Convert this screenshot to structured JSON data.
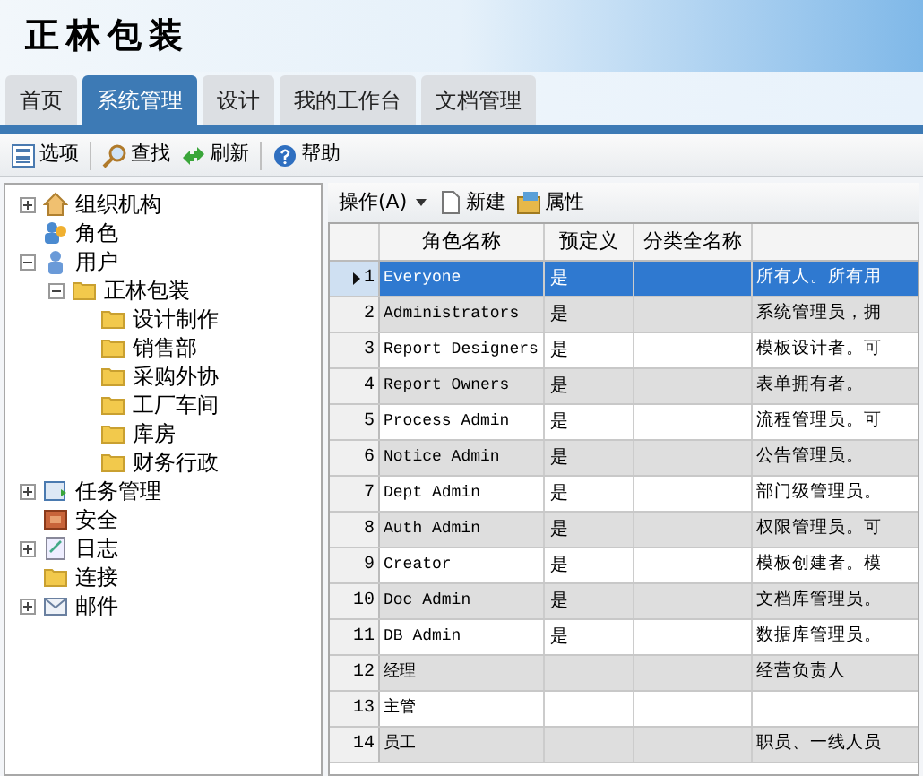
{
  "app_title": "正林包装",
  "tabs": [
    {
      "label": "首页",
      "selected": false
    },
    {
      "label": "系统管理",
      "selected": true
    },
    {
      "label": "设计",
      "selected": false
    },
    {
      "label": "我的工作台",
      "selected": false
    },
    {
      "label": "文档管理",
      "selected": false
    }
  ],
  "toolbar": [
    {
      "kind": "options",
      "label": "选项"
    },
    {
      "kind": "search",
      "label": "查找"
    },
    {
      "kind": "refresh",
      "label": "刷新"
    },
    {
      "kind": "help",
      "label": "帮助"
    }
  ],
  "tree": [
    {
      "label": "组织机构",
      "kind": "org",
      "expanded": false
    },
    {
      "label": "角色",
      "kind": "role"
    },
    {
      "label": "用户",
      "kind": "user",
      "expanded": true,
      "children": [
        {
          "label": "正林包装",
          "kind": "folder",
          "expanded": true,
          "children": [
            {
              "label": "设计制作",
              "kind": "folder"
            },
            {
              "label": "销售部",
              "kind": "folder"
            },
            {
              "label": "采购外协",
              "kind": "folder"
            },
            {
              "label": "工厂车间",
              "kind": "folder"
            },
            {
              "label": "库房",
              "kind": "folder"
            },
            {
              "label": "财务行政",
              "kind": "folder"
            }
          ]
        }
      ]
    },
    {
      "label": "任务管理",
      "kind": "task",
      "expanded": false
    },
    {
      "label": "安全",
      "kind": "security"
    },
    {
      "label": "日志",
      "kind": "log",
      "expanded": false
    },
    {
      "label": "连接",
      "kind": "folder"
    },
    {
      "label": "邮件",
      "kind": "mail",
      "expanded": false
    }
  ],
  "grid_toolbar": [
    {
      "kind": "menu",
      "label": "操作(A)"
    },
    {
      "kind": "new",
      "label": "新建"
    },
    {
      "kind": "properties",
      "label": "属性"
    }
  ],
  "table": {
    "columns": [
      "角色名称",
      "预定义",
      "分类全名称"
    ],
    "rows": [
      {
        "number": "1",
        "name": "Everyone",
        "predefined": "是",
        "description": "所有人。所有用",
        "selected": true
      },
      {
        "number": "2",
        "name": "Administrators",
        "predefined": "是",
        "description": "系统管理员，拥",
        "selected": false
      },
      {
        "number": "3",
        "name": "Report Designers",
        "predefined": "是",
        "description": "模板设计者。可",
        "selected": false
      },
      {
        "number": "4",
        "name": "Report Owners",
        "predefined": "是",
        "description": "表单拥有者。",
        "selected": false
      },
      {
        "number": "5",
        "name": "Process Admin",
        "predefined": "是",
        "description": "流程管理员。可",
        "selected": false
      },
      {
        "number": "6",
        "name": "Notice Admin",
        "predefined": "是",
        "description": "公告管理员。",
        "selected": false
      },
      {
        "number": "7",
        "name": "Dept Admin",
        "predefined": "是",
        "description": "部门级管理员。",
        "selected": false
      },
      {
        "number": "8",
        "name": "Auth Admin",
        "predefined": "是",
        "description": "权限管理员。可",
        "selected": false
      },
      {
        "number": "9",
        "name": "Creator",
        "predefined": "是",
        "description": "模板创建者。模",
        "selected": false
      },
      {
        "number": "10",
        "name": "Doc Admin",
        "predefined": "是",
        "description": "文档库管理员。",
        "selected": false
      },
      {
        "number": "11",
        "name": "DB Admin",
        "predefined": "是",
        "description": "数据库管理员。",
        "selected": false
      },
      {
        "number": "12",
        "name": "经理",
        "description": "经营负责人",
        "selected": false
      },
      {
        "number": "13",
        "name": "主管",
        "selected": false
      },
      {
        "number": "14",
        "name": "员工",
        "description": "职员、一线人员",
        "selected": false
      }
    ]
  }
}
